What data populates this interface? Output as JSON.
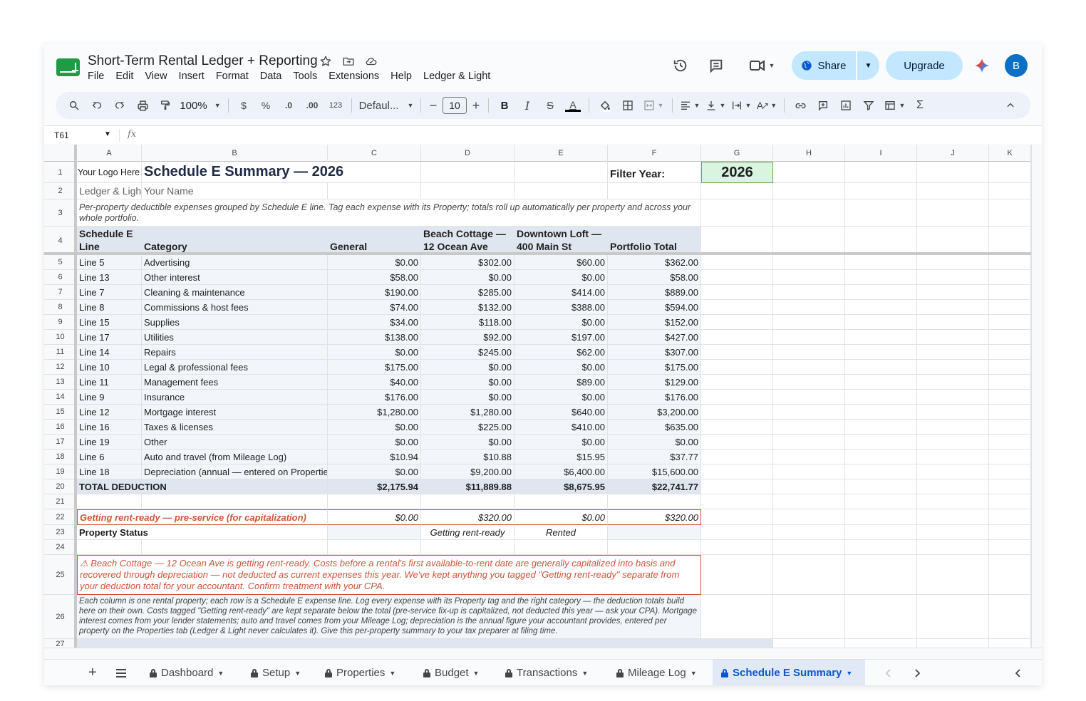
{
  "doc": {
    "title": "Short-Term Rental Ledger + Reporting",
    "menu": [
      "File",
      "Edit",
      "View",
      "Insert",
      "Format",
      "Data",
      "Tools",
      "Extensions",
      "Help",
      "Ledger & Light"
    ],
    "share_label": "Share",
    "upgrade_label": "Upgrade",
    "avatar_letter": "B"
  },
  "toolbar": {
    "zoom": "100%",
    "currency": "$",
    "percent": "%",
    "dec_less": ".0",
    "dec_more": ".00",
    "number_format": "123",
    "font": "Defaul...",
    "font_size": "10"
  },
  "formula_bar": {
    "name_box": "T61",
    "fx": "fx"
  },
  "columns": [
    "A",
    "B",
    "C",
    "D",
    "E",
    "F",
    "G",
    "H",
    "I",
    "J",
    "K"
  ],
  "sheet": {
    "logo": "Your Logo Here",
    "title": "Schedule E Summary — 2026",
    "filter_label": "Filter Year:",
    "filter_value": "2026",
    "brand": "Ledger & Light",
    "your_name": "Your Name",
    "description": "Per-property deductible expenses grouped by Schedule E line. Tag each expense with its Property; totals roll up automatically per property and across your whole portfolio.",
    "headers": [
      "Schedule E Line",
      "Category",
      "General",
      "Beach Cottage — 12 Ocean Ave",
      "Downtown Loft — 400 Main St",
      "Portfolio Total"
    ],
    "rows": [
      [
        "Line 5",
        "Advertising",
        "$0.00",
        "$302.00",
        "$60.00",
        "$362.00"
      ],
      [
        "Line 13",
        "Other interest",
        "$58.00",
        "$0.00",
        "$0.00",
        "$58.00"
      ],
      [
        "Line 7",
        "Cleaning & maintenance",
        "$190.00",
        "$285.00",
        "$414.00",
        "$889.00"
      ],
      [
        "Line 8",
        "Commissions & host fees",
        "$74.00",
        "$132.00",
        "$388.00",
        "$594.00"
      ],
      [
        "Line 15",
        "Supplies",
        "$34.00",
        "$118.00",
        "$0.00",
        "$152.00"
      ],
      [
        "Line 17",
        "Utilities",
        "$138.00",
        "$92.00",
        "$197.00",
        "$427.00"
      ],
      [
        "Line 14",
        "Repairs",
        "$0.00",
        "$245.00",
        "$62.00",
        "$307.00"
      ],
      [
        "Line 10",
        "Legal & professional fees",
        "$175.00",
        "$0.00",
        "$0.00",
        "$175.00"
      ],
      [
        "Line 11",
        "Management fees",
        "$40.00",
        "$0.00",
        "$89.00",
        "$129.00"
      ],
      [
        "Line 9",
        "Insurance",
        "$176.00",
        "$0.00",
        "$0.00",
        "$176.00"
      ],
      [
        "Line 12",
        "Mortgage interest",
        "$1,280.00",
        "$1,280.00",
        "$640.00",
        "$3,200.00"
      ],
      [
        "Line 16",
        "Taxes & licenses",
        "$0.00",
        "$225.00",
        "$410.00",
        "$635.00"
      ],
      [
        "Line 19",
        "Other",
        "$0.00",
        "$0.00",
        "$0.00",
        "$0.00"
      ],
      [
        "Line 6",
        "Auto and travel (from Mileage Log)",
        "$10.94",
        "$10.88",
        "$15.95",
        "$37.77"
      ],
      [
        "Line 18",
        "Depreciation (annual — entered on Properties tab)",
        "$0.00",
        "$9,200.00",
        "$6,400.00",
        "$15,600.00"
      ]
    ],
    "total": [
      "TOTAL DEDUCTION",
      "$2,175.94",
      "$11,889.88",
      "$8,675.95",
      "$22,741.77"
    ],
    "rent_ready": [
      "Getting rent-ready — pre-service (for capitalization)",
      "$0.00",
      "$320.00",
      "$0.00",
      "$320.00"
    ],
    "status": [
      "Property Status",
      "",
      "Getting rent-ready",
      "Rented",
      ""
    ],
    "warning": "⚠ Beach Cottage — 12 Ocean Ave is getting rent-ready. Costs before a rental's first available-to-rent date are generally capitalized into basis and recovered through depreciation — not deducted as current expenses this year. We've kept anything you tagged \"Getting rent-ready\" separate from your deduction total for your accountant. Confirm treatment with your CPA.",
    "note": "Each column is one rental property; each row is a Schedule E expense line. Log every expense with its Property tag and the right category — the deduction totals build here on their own. Costs tagged \"Getting rent-ready\" are kept separate below the total (pre-service fix-up is capitalized, not deducted this year — ask your CPA). Mortgage interest comes from your lender statements; auto and travel comes from your Mileage Log; depreciation is the annual figure your accountant provides, entered per property on the Properties tab (Ledger & Light never calculates it). Give this per-property summary to your tax preparer at filing time."
  },
  "tabs": [
    "Dashboard",
    "Setup",
    "Properties",
    "Budget",
    "Transactions",
    "Mileage Log",
    "Schedule E Summary"
  ],
  "colors": {
    "accent": "#0b57d0",
    "header_fill": "#e0e6ef",
    "warning_text": "#c9553a",
    "filter_fill": "#d9f5e0",
    "brand_green": "#1e9b45"
  }
}
